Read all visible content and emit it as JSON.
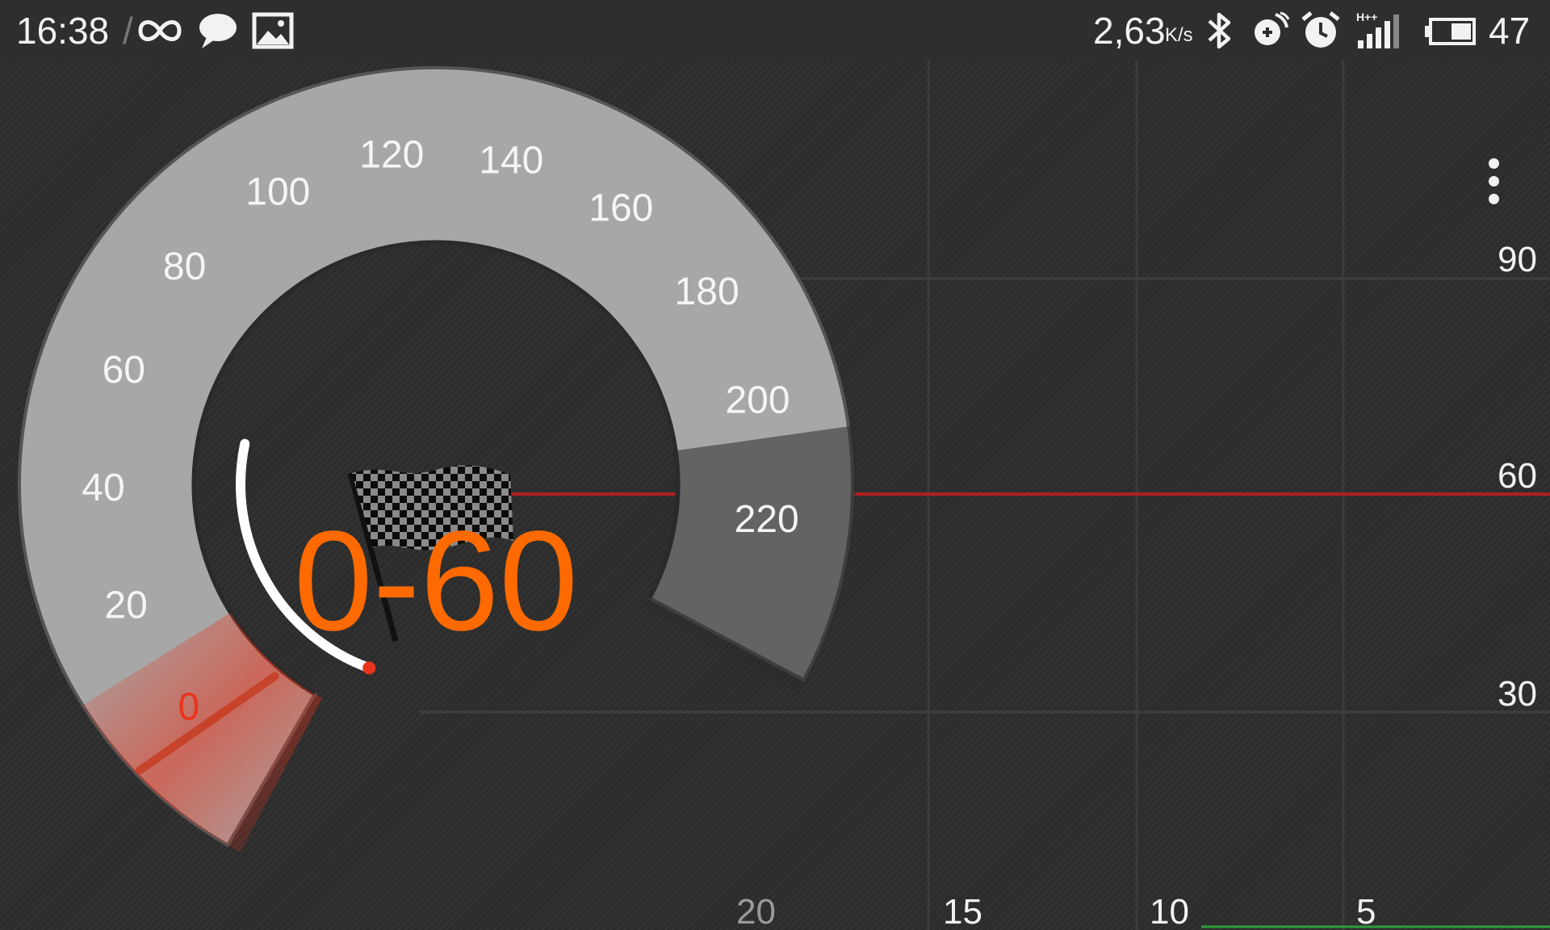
{
  "status_bar": {
    "time": "16:38",
    "separator": "/",
    "net_speed_value": "2,63",
    "net_speed_unit": "K/s",
    "battery_level": "47",
    "icons": [
      "infinity-icon",
      "chat-bubble-icon",
      "image-icon",
      "bluetooth-icon",
      "rotate-icon",
      "alarm-icon",
      "signal-hplus-icon",
      "battery-icon"
    ]
  },
  "gauge": {
    "tick_labels": [
      "0",
      "20",
      "40",
      "60",
      "80",
      "100",
      "120",
      "140",
      "160",
      "180",
      "200",
      "220"
    ],
    "mode_label": "0-60",
    "current_speed": 0,
    "icon": "checkered-flag-icon"
  },
  "graph": {
    "y_labels": [
      "90",
      "60",
      "30"
    ],
    "x_labels": [
      "20",
      "15",
      "10",
      "5"
    ],
    "target_speed": 60
  },
  "menu": {
    "icon": "overflow-menu-icon"
  },
  "colors": {
    "accent": "#ff6a00",
    "needle_red": "#e8341c",
    "target_line": "#b02020",
    "dial_face": "#a7a7a7",
    "text": "#f2f2f2",
    "trace_green": "#2e9e3a"
  }
}
